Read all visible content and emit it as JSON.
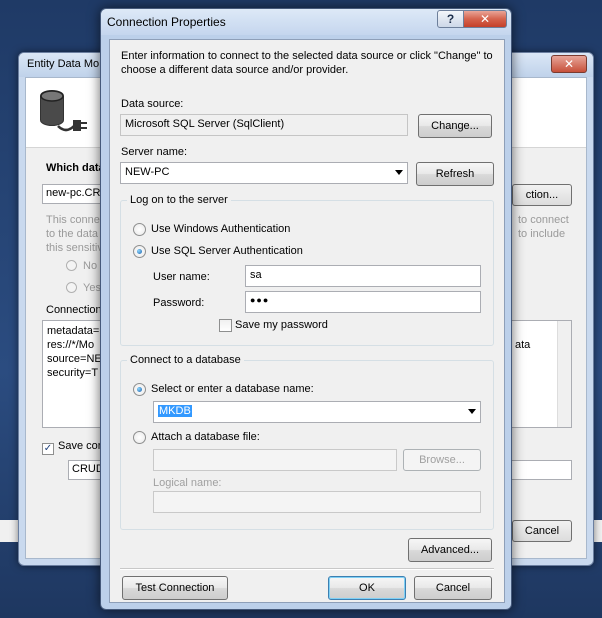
{
  "background_window": {
    "title": "Entity Data Mo",
    "which_data_label": "Which data",
    "connection_combo_value": "new-pc.CR",
    "new_connection_button": "ction...",
    "info_text_left": [
      "This conne",
      "to the data",
      "this sensitiv"
    ],
    "info_text_right": [
      "to connect",
      "to include"
    ],
    "radio_no": "No",
    "radio_yes": "Yes",
    "connection_string_label": "Connection",
    "connection_string_lines": [
      "metadata=",
      "res://*/Mo",
      "source=NE",
      "security=T"
    ],
    "connection_string_right": "ata",
    "save_label": "Save con",
    "entity_name_value": "CRUD",
    "cancel_button": "Cancel"
  },
  "dialog": {
    "title": "Connection Properties",
    "help_button": "?",
    "close_button": "✕",
    "instructions_line1": "Enter information to connect to the selected data source or click \"Change\" to",
    "instructions_line2": "choose a different data source and/or provider.",
    "data_source_label": "Data source:",
    "data_source_value": "Microsoft SQL Server (SqlClient)",
    "change_button": "Change...",
    "server_name_label": "Server name:",
    "server_name_value": "NEW-PC",
    "refresh_button": "Refresh",
    "logon_group": "Log on to the server",
    "windows_auth_label": "Use Windows Authentication",
    "sql_auth_label": "Use SQL Server Authentication",
    "auth_selected": "sql",
    "user_name_label": "User name:",
    "user_name_value": "sa",
    "password_label": "Password:",
    "password_value": "●●●",
    "save_password_label": "Save my password",
    "save_password_checked": false,
    "connect_group": "Connect to a database",
    "select_db_label": "Select or enter a database name:",
    "database_name_value": "MKDB",
    "attach_db_label": "Attach a database file:",
    "attach_file_value": "",
    "browse_button": "Browse...",
    "logical_name_label": "Logical name:",
    "logical_name_value": "",
    "advanced_button": "Advanced...",
    "test_connection_button": "Test Connection",
    "ok_button": "OK",
    "cancel_button": "Cancel"
  }
}
